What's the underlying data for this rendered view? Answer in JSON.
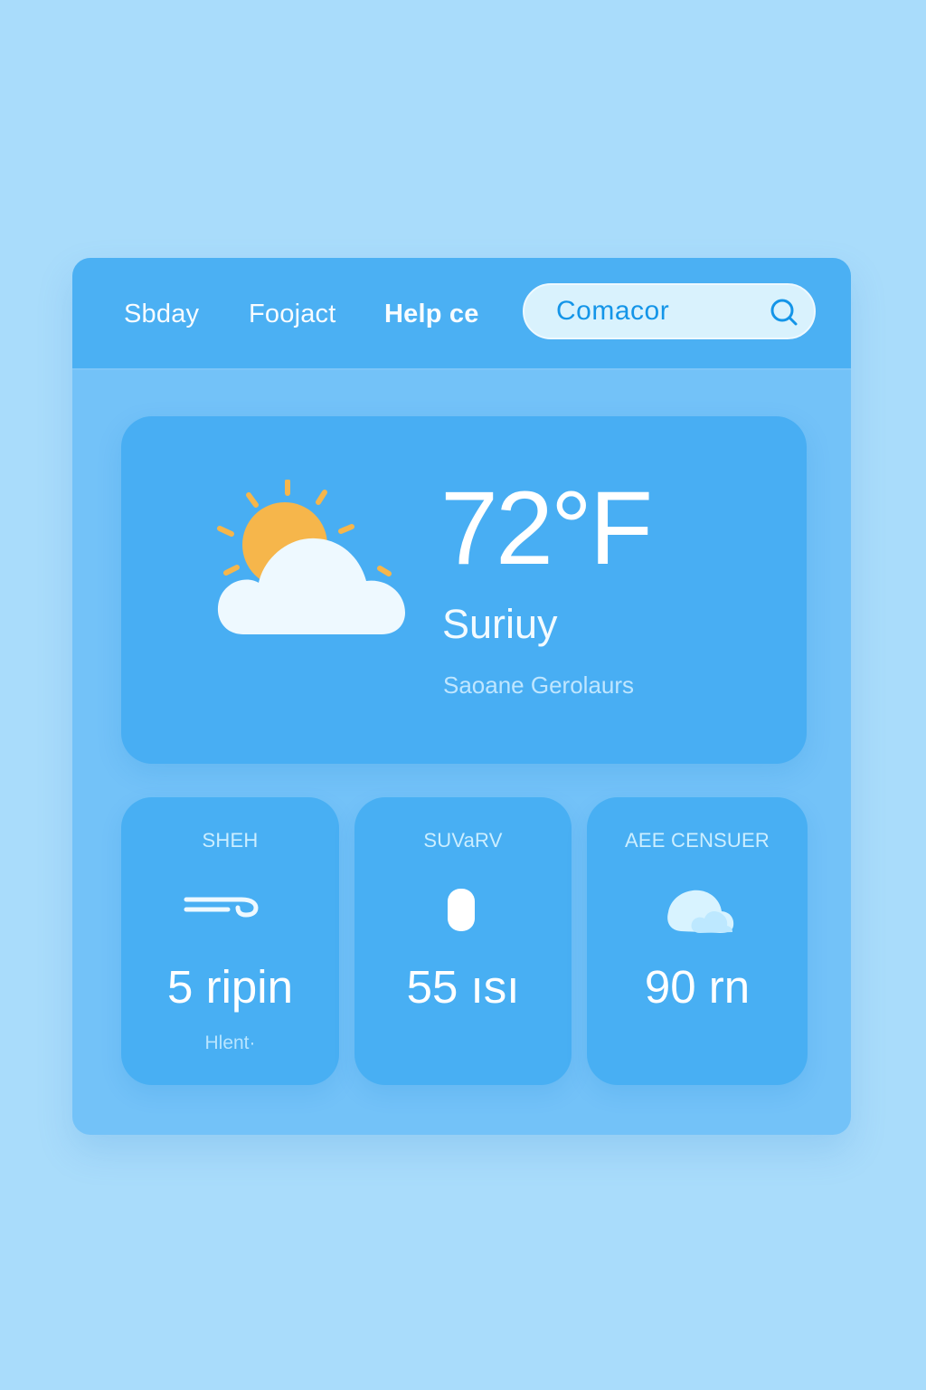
{
  "header": {
    "nav": [
      {
        "label": "Sbday"
      },
      {
        "label": "Foojact"
      },
      {
        "label": "Help ce"
      }
    ],
    "search": {
      "value": "Comacor",
      "icon": "search-icon"
    }
  },
  "current": {
    "temperature": "72°F",
    "condition": "Suriuy",
    "location": "Saoane Gerolaurs",
    "icon": "partly-sunny-icon"
  },
  "metrics": [
    {
      "title": "SHEH",
      "value": "5 ripin",
      "subtext": "Hlent·",
      "icon": "wind-icon"
    },
    {
      "title": "SUVaRV",
      "value": "55 ısı",
      "icon": "humidity-icon"
    },
    {
      "title": "AEE CENSUER",
      "value": "90 rn",
      "icon": "air-quality-icon"
    }
  ],
  "colors": {
    "background": "#a9dcfb",
    "panel": "#73c2f8",
    "header": "#4bb0f3",
    "card": "#48aef3",
    "sun": "#f6b64b",
    "cloud": "#eef9ff",
    "search_text": "#1495e8"
  }
}
